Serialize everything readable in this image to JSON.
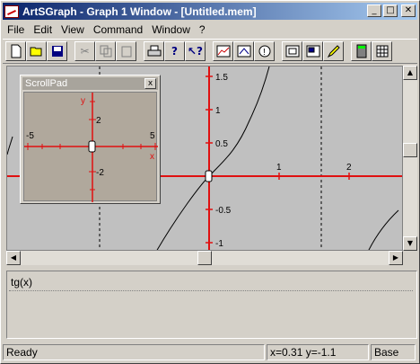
{
  "window": {
    "title": "ArtSGraph - Graph 1 Window - [Untitled.mem]",
    "min_label": "_",
    "max_label": "□",
    "close_label": "✕"
  },
  "menu": {
    "items": [
      "File",
      "Edit",
      "View",
      "Command",
      "Window",
      "?"
    ]
  },
  "toolbar": {
    "icons": [
      "new-icon",
      "open-icon",
      "save-icon",
      "cut-icon",
      "copy-icon",
      "paste-icon",
      "print-icon",
      "help-icon",
      "context-help-icon",
      "graph-icon",
      "zoom-icon",
      "info-icon",
      "fit-icon",
      "zoom-box-icon",
      "pencil-icon",
      "calculator-icon",
      "table-icon"
    ]
  },
  "graph": {
    "y_ticks": [
      "1.5",
      "1",
      "0.5",
      "-0.5",
      "-1"
    ],
    "x_ticks": [
      "1",
      "2"
    ]
  },
  "scrollpad": {
    "title": "ScrollPad",
    "close_label": "x",
    "x_label": "x",
    "y_label": "y",
    "ticks": [
      "-5",
      "5",
      "2",
      "-2"
    ]
  },
  "expressions": {
    "items": [
      "tg(x)"
    ]
  },
  "status": {
    "ready": "Ready",
    "coords": "x=0.31 y=-1.1",
    "mode": "Base"
  }
}
